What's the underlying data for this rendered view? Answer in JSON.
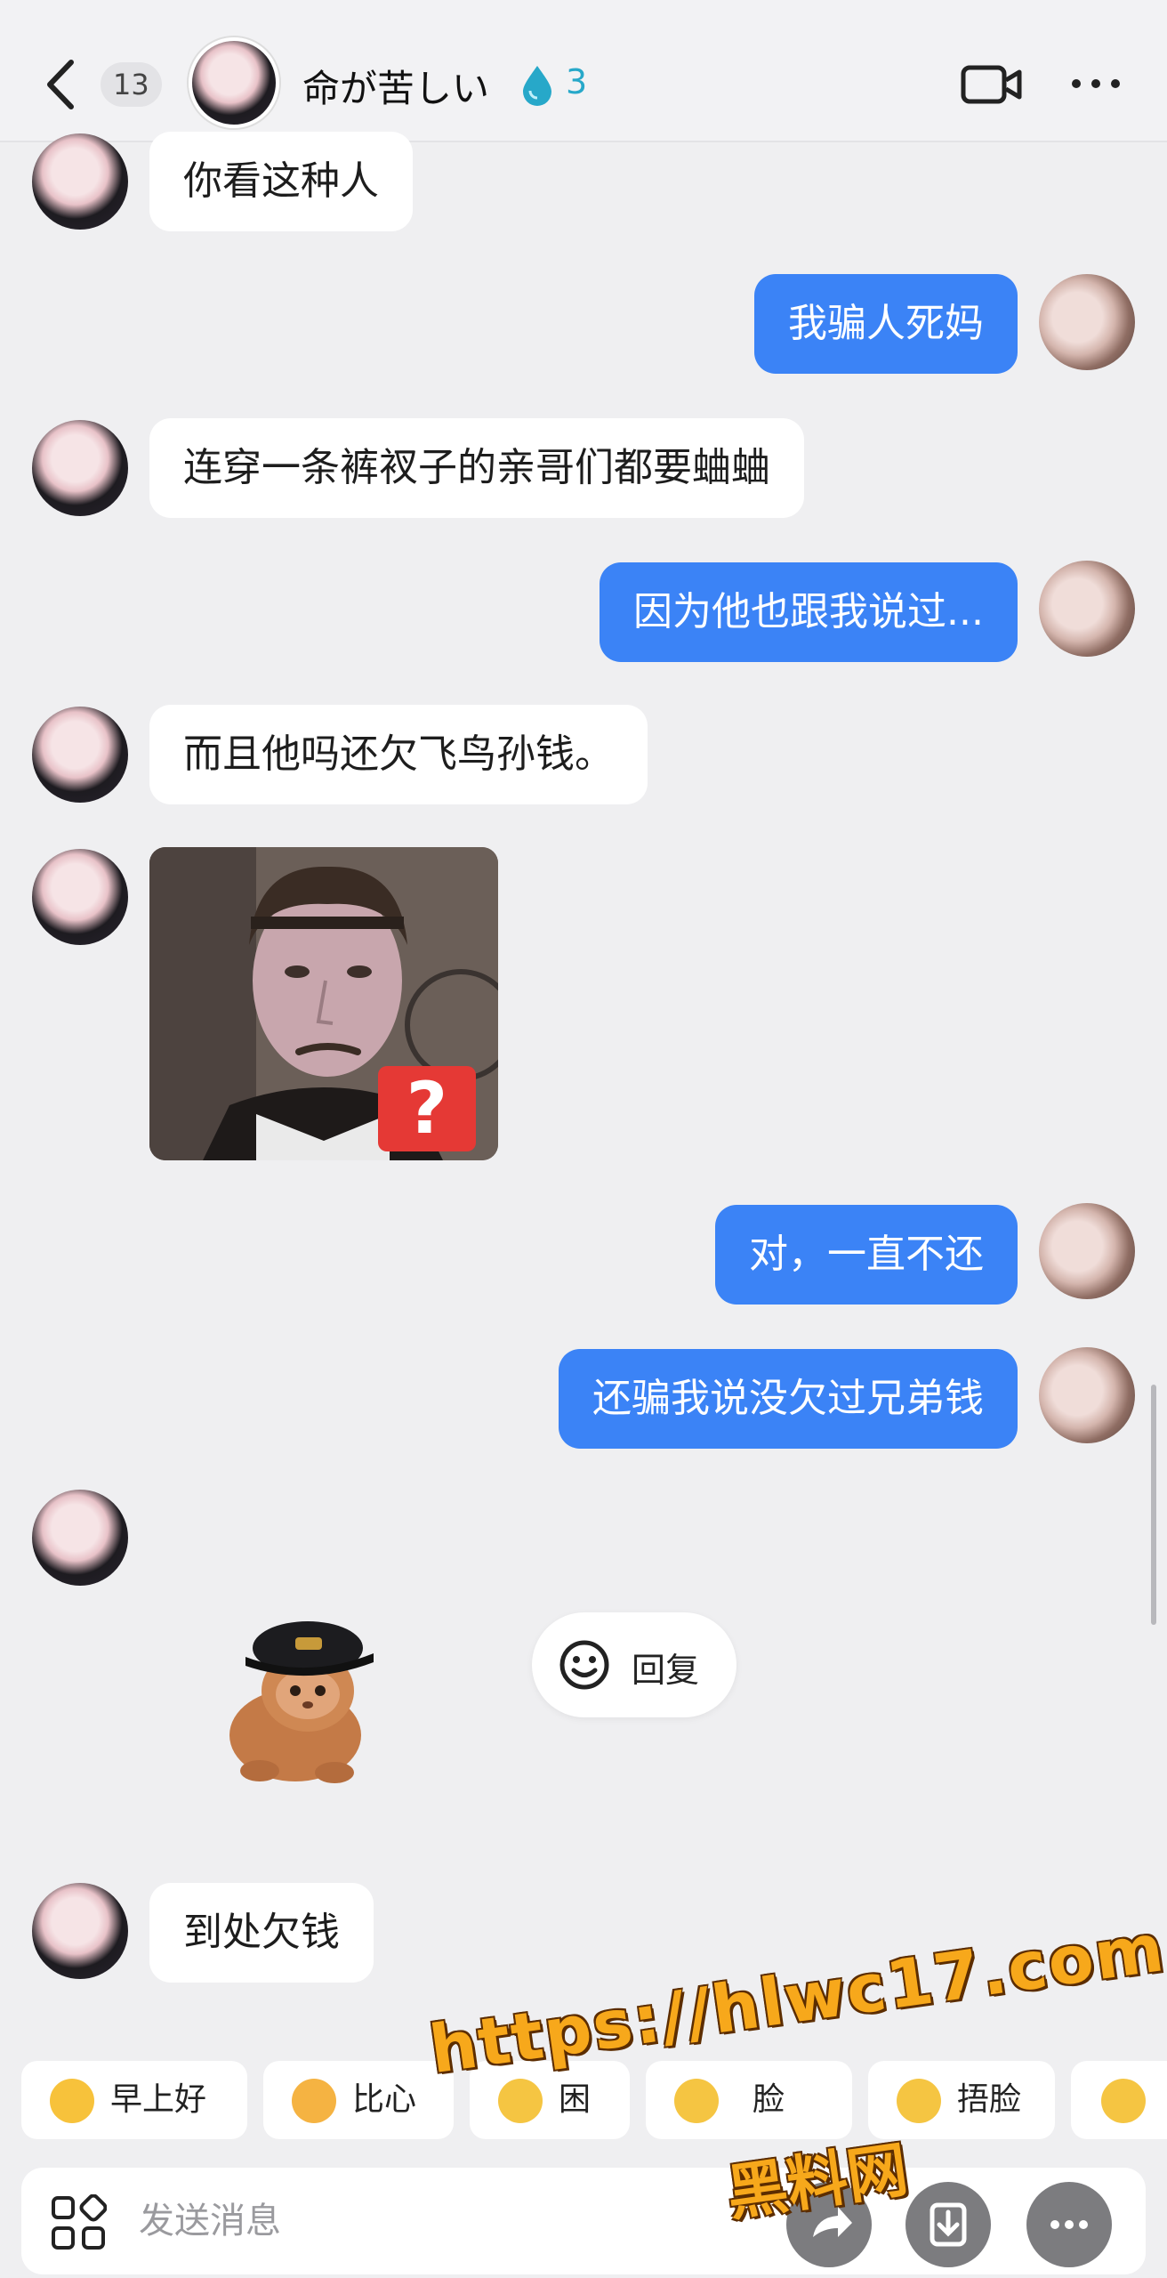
{
  "header": {
    "back_icon": "chevron-left-icon",
    "unread_count": "13",
    "contact_name": "命が苦しい",
    "streak_icon": "water-drop-icon",
    "streak_count": "3",
    "video_icon": "video-camera-icon",
    "more_icon": "more-horizontal-icon"
  },
  "messages": [
    {
      "side": "in",
      "type": "text",
      "text": "你看这种人"
    },
    {
      "side": "out",
      "type": "text",
      "text": "我骗人死妈"
    },
    {
      "side": "in",
      "type": "text",
      "text": "连穿一条裤衩子的亲哥们都要蛐蛐"
    },
    {
      "side": "out",
      "type": "text",
      "text": "因为他也跟我说过..."
    },
    {
      "side": "in",
      "type": "text",
      "text": "而且他吗还欠飞鸟孙钱。"
    },
    {
      "side": "in",
      "type": "image",
      "overlay": "?"
    },
    {
      "side": "out",
      "type": "text",
      "text": "对，一直不还"
    },
    {
      "side": "out",
      "type": "text",
      "text": "还骗我说没欠过兄弟钱"
    },
    {
      "side": "in",
      "type": "sticker",
      "sticker": "cat-with-cap"
    },
    {
      "side": "in",
      "type": "text",
      "text": "到处欠钱"
    }
  ],
  "reply_popup": {
    "icon": "smiley-icon",
    "label": "回复"
  },
  "quick_replies": [
    {
      "label": "早上好",
      "color": "#f7c23b"
    },
    {
      "label": "比心",
      "color": "#f5b342"
    },
    {
      "label": "困",
      "color": "#f5c542"
    },
    {
      "label": "脸",
      "color": "#f5c542"
    },
    {
      "label": "捂脸",
      "color": "#f5c542"
    },
    {
      "label": "",
      "color": "#f5c542"
    }
  ],
  "input": {
    "apps_icon": "apps-grid-icon",
    "placeholder": "发送消息",
    "buttons": [
      "share-icon",
      "download-icon",
      "more-horizontal-icon"
    ]
  },
  "watermark": {
    "line1": "https://hlwc17.com",
    "line2": "黑料网"
  },
  "colors": {
    "out_bubble": "#3b83f6",
    "in_bubble": "#ffffff",
    "background": "#efeff1",
    "streak": "#27a8c9",
    "watermark": "#f7a81b"
  }
}
